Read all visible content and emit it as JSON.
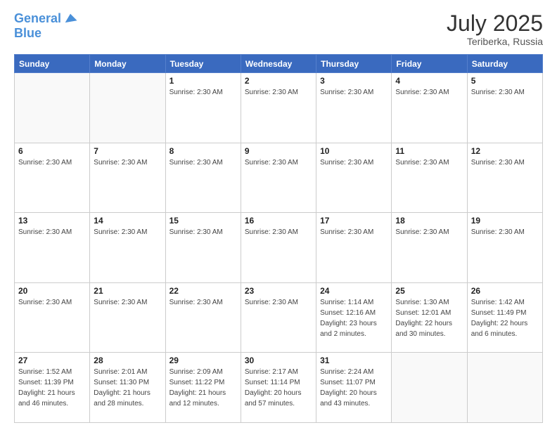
{
  "logo": {
    "line1": "General",
    "line2": "Blue"
  },
  "header": {
    "month_year": "July 2025",
    "location": "Teriberka, Russia"
  },
  "days_of_week": [
    "Sunday",
    "Monday",
    "Tuesday",
    "Wednesday",
    "Thursday",
    "Friday",
    "Saturday"
  ],
  "weeks": [
    [
      {
        "day": "",
        "info": ""
      },
      {
        "day": "",
        "info": ""
      },
      {
        "day": "1",
        "info": "Sunrise: 2:30 AM"
      },
      {
        "day": "2",
        "info": "Sunrise: 2:30 AM"
      },
      {
        "day": "3",
        "info": "Sunrise: 2:30 AM"
      },
      {
        "day": "4",
        "info": "Sunrise: 2:30 AM"
      },
      {
        "day": "5",
        "info": "Sunrise: 2:30 AM"
      }
    ],
    [
      {
        "day": "6",
        "info": "Sunrise: 2:30 AM"
      },
      {
        "day": "7",
        "info": "Sunrise: 2:30 AM"
      },
      {
        "day": "8",
        "info": "Sunrise: 2:30 AM"
      },
      {
        "day": "9",
        "info": "Sunrise: 2:30 AM"
      },
      {
        "day": "10",
        "info": "Sunrise: 2:30 AM"
      },
      {
        "day": "11",
        "info": "Sunrise: 2:30 AM"
      },
      {
        "day": "12",
        "info": "Sunrise: 2:30 AM"
      }
    ],
    [
      {
        "day": "13",
        "info": "Sunrise: 2:30 AM"
      },
      {
        "day": "14",
        "info": "Sunrise: 2:30 AM"
      },
      {
        "day": "15",
        "info": "Sunrise: 2:30 AM"
      },
      {
        "day": "16",
        "info": "Sunrise: 2:30 AM"
      },
      {
        "day": "17",
        "info": "Sunrise: 2:30 AM"
      },
      {
        "day": "18",
        "info": "Sunrise: 2:30 AM"
      },
      {
        "day": "19",
        "info": "Sunrise: 2:30 AM"
      }
    ],
    [
      {
        "day": "20",
        "info": "Sunrise: 2:30 AM"
      },
      {
        "day": "21",
        "info": "Sunrise: 2:30 AM"
      },
      {
        "day": "22",
        "info": "Sunrise: 2:30 AM"
      },
      {
        "day": "23",
        "info": "Sunrise: 2:30 AM"
      },
      {
        "day": "24",
        "info": "Sunrise: 1:14 AM\nSunset: 12:16 AM\nDaylight: 23 hours and 2 minutes."
      },
      {
        "day": "25",
        "info": "Sunrise: 1:30 AM\nSunset: 12:01 AM\nDaylight: 22 hours and 30 minutes."
      },
      {
        "day": "26",
        "info": "Sunrise: 1:42 AM\nSunset: 11:49 PM\nDaylight: 22 hours and 6 minutes."
      }
    ],
    [
      {
        "day": "27",
        "info": "Sunrise: 1:52 AM\nSunset: 11:39 PM\nDaylight: 21 hours and 46 minutes."
      },
      {
        "day": "28",
        "info": "Sunrise: 2:01 AM\nSunset: 11:30 PM\nDaylight: 21 hours and 28 minutes."
      },
      {
        "day": "29",
        "info": "Sunrise: 2:09 AM\nSunset: 11:22 PM\nDaylight: 21 hours and 12 minutes."
      },
      {
        "day": "30",
        "info": "Sunrise: 2:17 AM\nSunset: 11:14 PM\nDaylight: 20 hours and 57 minutes."
      },
      {
        "day": "31",
        "info": "Sunrise: 2:24 AM\nSunset: 11:07 PM\nDaylight: 20 hours and 43 minutes."
      },
      {
        "day": "",
        "info": ""
      },
      {
        "day": "",
        "info": ""
      }
    ]
  ]
}
